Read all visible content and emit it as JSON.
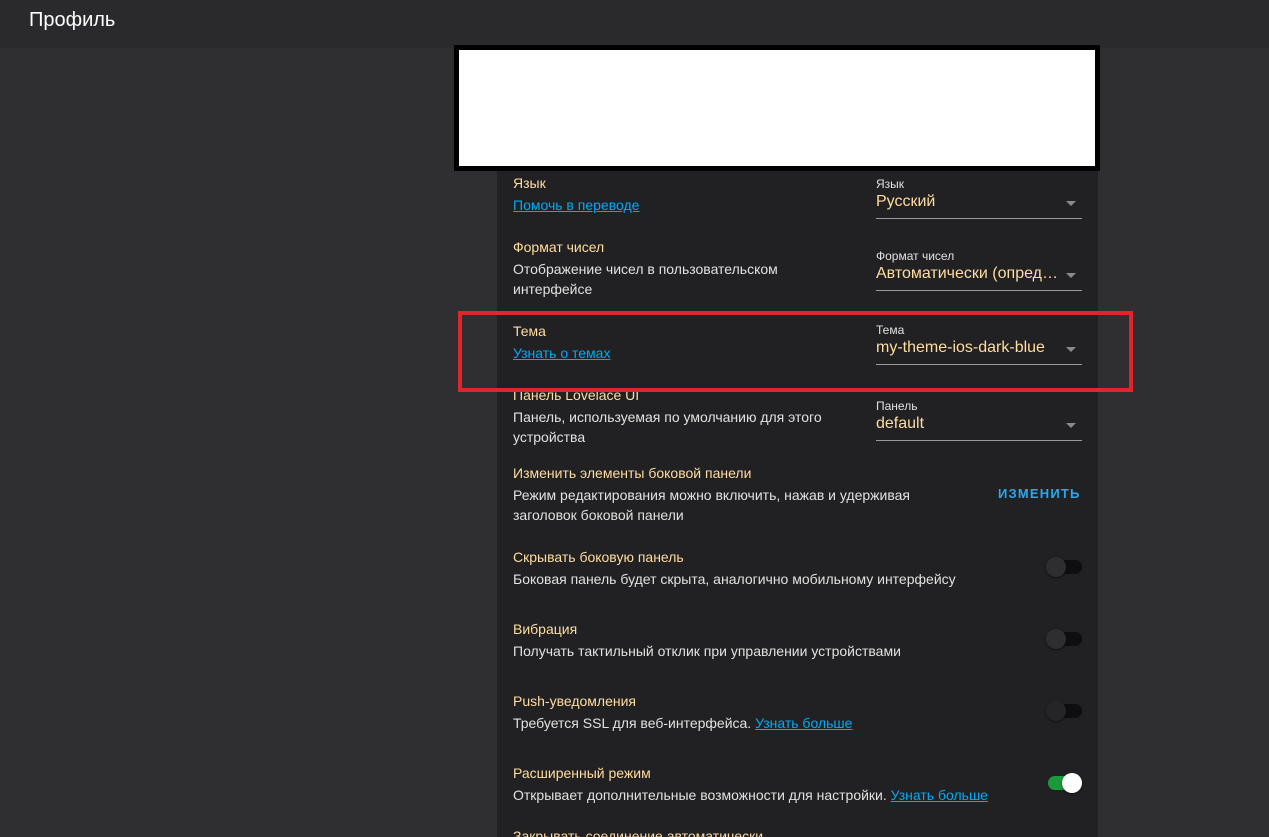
{
  "header": {
    "title": "Профиль"
  },
  "language": {
    "title": "Язык",
    "link": "Помочь в переводе",
    "select_label": "Язык",
    "select_value": "Русский"
  },
  "number_format": {
    "title": "Формат чисел",
    "desc": "Отображение чисел в пользовательском интерфейсе",
    "select_label": "Формат чисел",
    "select_value": "Автоматически (опреде..."
  },
  "theme": {
    "title": "Тема",
    "link": "Узнать о темах",
    "select_label": "Тема",
    "select_value": "my-theme-ios-dark-blue"
  },
  "dashboard": {
    "title": "Панель Lovelace UI",
    "desc": "Панель, используемая по умолчанию для этого устройства",
    "select_label": "Панель",
    "select_value": "default"
  },
  "sidebar_edit": {
    "title": "Изменить элементы боковой панели",
    "desc": "Режим редактирования можно включить, нажав и удерживая заголовок боковой панели",
    "button": "ИЗМЕНИТЬ"
  },
  "hide_sidebar": {
    "title": "Скрывать боковую панель",
    "desc": "Боковая панель будет скрыта, аналогично мобильному интерфейсу",
    "enabled": false
  },
  "vibration": {
    "title": "Вибрация",
    "desc": "Получать тактильный отклик при управлении устройствами",
    "enabled": false
  },
  "push": {
    "title": "Push-уведомления",
    "desc": "Требуется SSL для веб-интерфейса.",
    "link": "Узнать больше",
    "enabled": false
  },
  "advanced": {
    "title": "Расширенный режим",
    "desc": "Открывает дополнительные возможности для настройки.",
    "link": "Узнать больше",
    "enabled": true
  },
  "auto_close": {
    "title": "Закрывать соединение автоматически"
  },
  "colors": {
    "background": "#2f2f31",
    "card": "#212123",
    "title_text": "#ffdca0",
    "link": "#03a9f4",
    "toggle_on": "#1b9a3a",
    "highlight": "#e0252b"
  }
}
